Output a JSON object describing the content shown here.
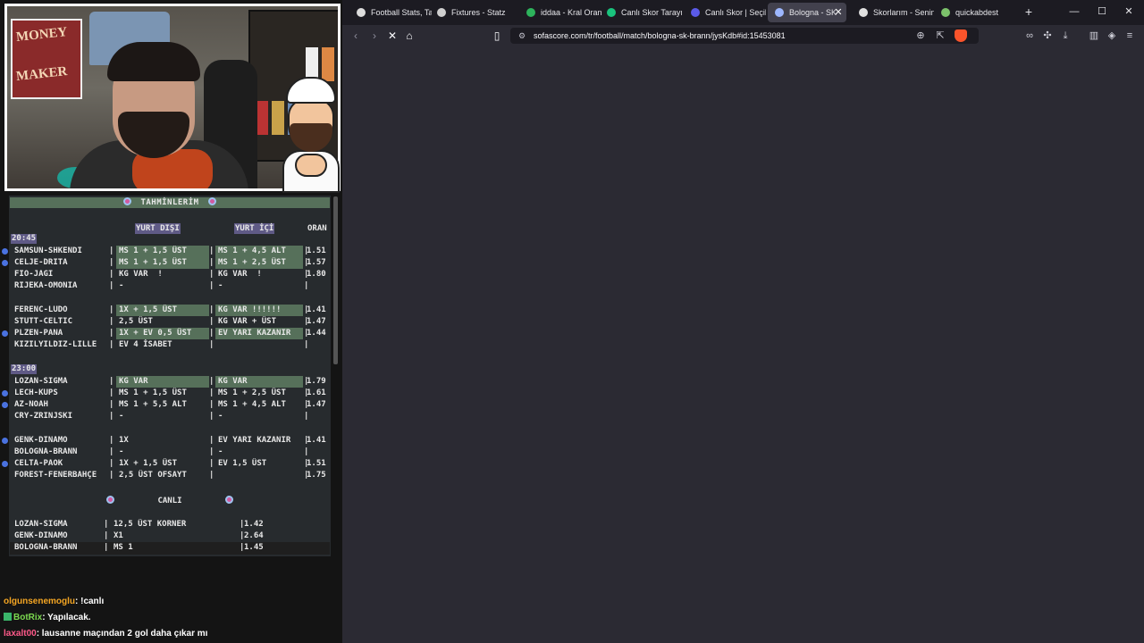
{
  "overlay": {
    "board_title": "TAHMİNLERİM",
    "headers": {
      "yurt_disi": "YURT DIŞI",
      "yurt_ici": "YURT İÇİ",
      "oran": "ORAN"
    },
    "times": [
      "20:45",
      "23:00"
    ],
    "rows": [
      {
        "match": "SAMSUN-SHKENDI",
        "c1": "MS 1 + 1,5 ÜST",
        "c2": "MS 1 + 4,5 ALT",
        "odd": "1.51"
      },
      {
        "match": "CELJE-DRITA",
        "c1": "MS 1 + 1,5 ÜST",
        "c2": "MS 1 + 2,5 ÜST",
        "odd": "1.57"
      },
      {
        "match": "FIO-JAGI",
        "c1": "KG VAR  !",
        "c2": "KG VAR  !",
        "odd": "1.80"
      },
      {
        "match": "RIJEKA-OMONIA",
        "c1": "-",
        "c2": "-",
        "odd": ""
      },
      {
        "match": "FERENC-LUDO",
        "c1": "1X + 1,5 ÜST",
        "c2": "KG VAR !!!!!!",
        "odd": "1.41"
      },
      {
        "match": "STUTT-CELTIC",
        "c1": "2,5 ÜST",
        "c2": "KG VAR + ÜST",
        "odd": "1.47"
      },
      {
        "match": "PLZEN-PANA",
        "c1": "1X + EV 0,5 ÜST",
        "c2": "EV YARI KAZANIR",
        "odd": "1.44"
      },
      {
        "match": "KIZILYILDIZ-LILLE",
        "c1": "EV 4 İSABET",
        "c2": "",
        "odd": ""
      },
      {
        "match": "LOZAN-SIGMA",
        "c1": "KG VAR",
        "c2": "KG VAR",
        "odd": "1.79"
      },
      {
        "match": "LECH-KUPS",
        "c1": "MS 1 + 1,5 ÜST",
        "c2": "MS 1 + 2,5 ÜST",
        "odd": "1.61"
      },
      {
        "match": "AZ-NOAH",
        "c1": "MS 1 + 5,5 ALT",
        "c2": "MS 1 + 4,5 ALT",
        "odd": "1.47"
      },
      {
        "match": "CRY-ZRINJSKI",
        "c1": "-",
        "c2": "-",
        "odd": ""
      },
      {
        "match": "GENK-DINAMO",
        "c1": "1X",
        "c2": "EV YARI KAZANIR",
        "odd": "1.41"
      },
      {
        "match": "BOLOGNA-BRANN",
        "c1": "-",
        "c2": "-",
        "odd": ""
      },
      {
        "match": "CELTA-PAOK",
        "c1": "1X + 1,5 ÜST",
        "c2": "EV 1,5 ÜST",
        "odd": "1.51"
      },
      {
        "match": "FOREST-FENERBAHÇE",
        "c1": "2,5 ÜST OFSAYT",
        "c2": "",
        "odd": "1.75"
      }
    ],
    "live_title": "CANLI",
    "live_rows": [
      {
        "match": "LOZAN-SIGMA",
        "pick": "12,5 ÜST KORNER",
        "odd": "1.42"
      },
      {
        "match": "GENK-DINAMO",
        "pick": "X1",
        "odd": "2.64"
      },
      {
        "match": "BOLOGNA-BRANN",
        "pick": "MS 1",
        "odd": "1.45"
      }
    ],
    "colors": {
      "highlight": "#56705a",
      "header": "#5f5a86",
      "bullet": "#4a72e0"
    }
  },
  "chat": [
    {
      "user": "olgunsenemoglu",
      "user_color": "#f5a623",
      "message": ": !canlı"
    },
    {
      "user": "BotRix",
      "user_color": "#7bd84f",
      "message": ": Yapılacak.",
      "badge": true
    },
    {
      "user": "laxalt00",
      "user_color": "#ff5a8a",
      "message": ": lausanne maçından 2 gol daha çıkar mı"
    }
  ],
  "browser": {
    "tabs": [
      {
        "label": "Football Stats, Ta",
        "icon_color": "#dddddd"
      },
      {
        "label": "Fixtures - Statz",
        "icon_color": "#cfcfcf"
      },
      {
        "label": "iddaa - Kral Oran",
        "icon_color": "#2db35c"
      },
      {
        "label": "Canlı Skor Tarayı",
        "icon_color": "#19c37d"
      },
      {
        "label": "Canlı Skor | Seçil",
        "icon_color": "#5b5be8"
      },
      {
        "label": "Bologna - SK",
        "icon_color": "#9db7ff"
      },
      {
        "label": "Skorlarım - Senin",
        "icon_color": "#e0e0e0"
      },
      {
        "label": "quickabdest",
        "icon_color": "#7cc26b"
      }
    ],
    "active_tab_index": 5,
    "url": "sofascore.com/tr/football/match/bologna-sk-brann/jysKdb#id:15453081"
  }
}
